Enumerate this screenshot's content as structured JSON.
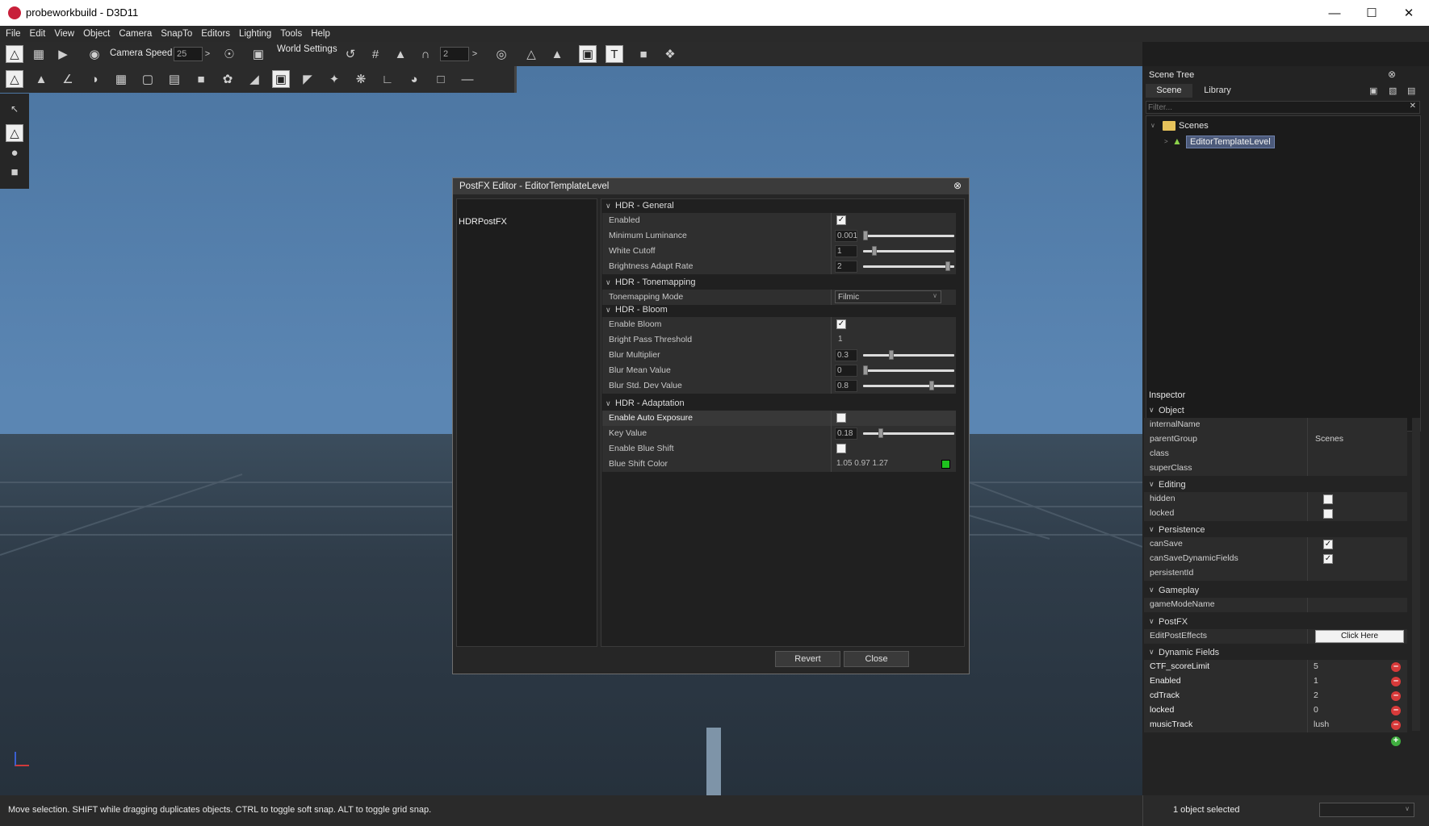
{
  "window": {
    "title": "probeworkbuild - D3D11"
  },
  "menu": [
    "File",
    "Edit",
    "View",
    "Object",
    "Camera",
    "SnapTo",
    "Editors",
    "Lighting",
    "Tools",
    "Help"
  ],
  "toolbar": {
    "camera_speed_label": "Camera Speed",
    "camera_speed_value": "25",
    "world_settings_label": "World Settings",
    "grid_value": "2"
  },
  "dialog": {
    "title": "PostFX Editor - EditorTemplateLevel",
    "list": [
      "HDRPostFX"
    ],
    "groups": {
      "general": {
        "title": "HDR - General",
        "enabled": "Enabled",
        "min_lum": "Minimum Luminance",
        "min_lum_val": "0.001",
        "white_cutoff": "White Cutoff",
        "white_cutoff_val": "1",
        "adapt_rate": "Brightness Adapt Rate",
        "adapt_rate_val": "2"
      },
      "tonemapping": {
        "title": "HDR - Tonemapping",
        "mode": "Tonemapping Mode",
        "mode_val": "Filmic"
      },
      "bloom": {
        "title": "HDR - Bloom",
        "enable": "Enable Bloom",
        "bright_pass": "Bright Pass Threshold",
        "bright_pass_val": "1",
        "blur_mult": "Blur Multiplier",
        "blur_mult_val": "0.3",
        "blur_mean": "Blur Mean Value",
        "blur_mean_val": "0",
        "blur_std": "Blur Std. Dev Value",
        "blur_std_val": "0.8"
      },
      "adaptation": {
        "title": "HDR - Adaptation",
        "auto_exposure": "Enable Auto Exposure",
        "key_value": "Key Value",
        "key_value_val": "0.18",
        "blue_shift": "Enable Blue Shift",
        "blue_shift_color": "Blue Shift Color",
        "blue_shift_color_val": "1.05 0.97 1.27"
      }
    },
    "revert": "Revert",
    "close": "Close",
    "slider_levels": {
      "min_lum": 0.0,
      "white_cutoff": 0.1,
      "adapt_rate": 0.97,
      "blur_mult": 0.3,
      "blur_mean": 0.0,
      "blur_std": 0.78,
      "key_value": 0.18
    }
  },
  "scene_tree": {
    "title": "Scene Tree",
    "tabs": [
      "Scene",
      "Library"
    ],
    "filter_placeholder": "Filter...",
    "root": "Scenes",
    "child": "EditorTemplateLevel"
  },
  "inspector": {
    "title": "Inspector",
    "object": {
      "title": "Object",
      "internalName": "internalName",
      "parentGroup": "parentGroup",
      "parentGroup_val": "Scenes",
      "class": "class",
      "superClass": "superClass"
    },
    "editing": {
      "title": "Editing",
      "hidden": "hidden",
      "locked": "locked"
    },
    "persistence": {
      "title": "Persistence",
      "canSave": "canSave",
      "canSaveDynamicFields": "canSaveDynamicFields",
      "persistentId": "persistentId"
    },
    "gameplay": {
      "title": "Gameplay",
      "gameModeName": "gameModeName"
    },
    "postfx": {
      "title": "PostFX",
      "editPostEffects": "EditPostEffects",
      "button": "Click Here"
    },
    "dynamic": {
      "title": "Dynamic Fields",
      "fields": [
        {
          "k": "CTF_scoreLimit",
          "v": "5"
        },
        {
          "k": "Enabled",
          "v": "1"
        },
        {
          "k": "cdTrack",
          "v": "2"
        },
        {
          "k": "locked",
          "v": "0"
        },
        {
          "k": "musicTrack",
          "v": "lush"
        }
      ]
    }
  },
  "status": {
    "message": "Move selection.  SHIFT while dragging duplicates objects.  CTRL to toggle soft snap.  ALT to toggle grid snap.",
    "selection": "1 object selected"
  },
  "colors": {
    "blue_shift_swatch": "#1ec21e"
  }
}
